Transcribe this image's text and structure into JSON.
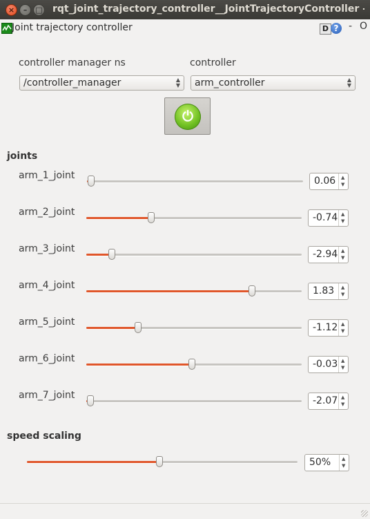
{
  "window": {
    "title": "rqt_joint_trajectory_controller__JointTrajectoryController - r",
    "close_glyph": "×",
    "minimize_glyph": "–",
    "maximize_glyph": "□"
  },
  "plugin": {
    "title": "Joint trajectory controller",
    "help_d": "D",
    "help_q": "?",
    "dash": "-",
    "close_o": "O"
  },
  "controller_manager": {
    "label": "controller manager ns",
    "value": "/controller_manager",
    "arrow": "▲▼"
  },
  "controller": {
    "label": "controller",
    "value": "arm_controller",
    "arrow": "▲▼"
  },
  "power": {
    "symbol": "⏻",
    "color": "#73c225"
  },
  "joints": {
    "heading": "joints",
    "items": [
      {
        "name": "arm_1_joint",
        "value": "0.06",
        "fraction": 0.02
      },
      {
        "name": "arm_2_joint",
        "value": "-0.74",
        "fraction": 0.3
      },
      {
        "name": "arm_3_joint",
        "value": "-2.94",
        "fraction": 0.12
      },
      {
        "name": "arm_4_joint",
        "value": "1.83",
        "fraction": 0.77
      },
      {
        "name": "arm_5_joint",
        "value": "-1.12",
        "fraction": 0.24
      },
      {
        "name": "arm_6_joint",
        "value": "-0.03",
        "fraction": 0.49
      },
      {
        "name": "arm_7_joint",
        "value": "-2.07",
        "fraction": 0.02
      }
    ]
  },
  "speed_scaling": {
    "heading": "speed scaling",
    "value": "50%",
    "fraction": 0.49
  },
  "spin_arrows": {
    "up": "▲",
    "down": "▼"
  },
  "colors": {
    "accent": "#e0562a"
  }
}
